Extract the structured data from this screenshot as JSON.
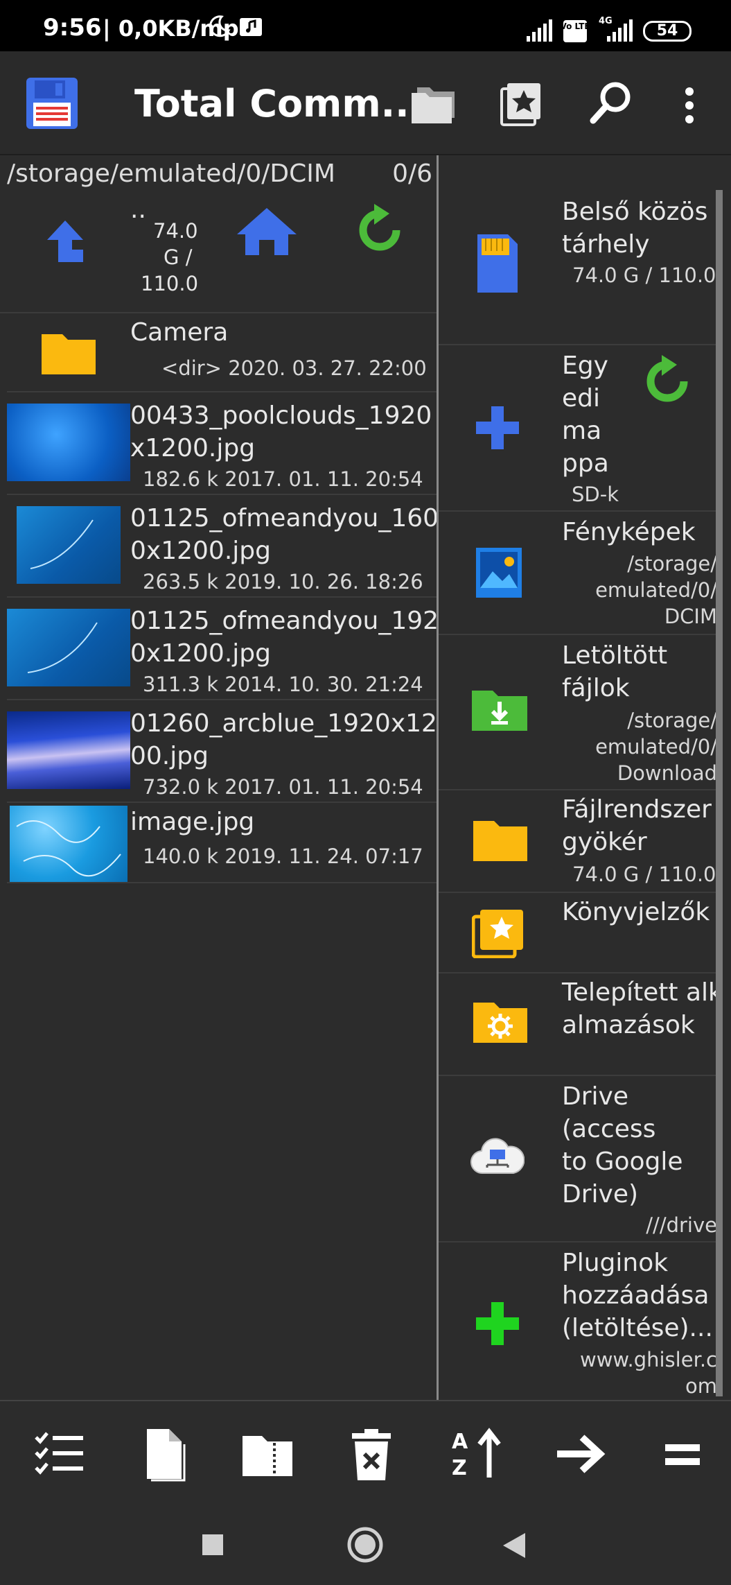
{
  "status_bar": {
    "time": "9:56",
    "network_speed": "| 0,0KB/mp",
    "battery": "54",
    "volte": "Vo LTE",
    "net_4g": "4G"
  },
  "header": {
    "title": "Total Comm..."
  },
  "left_panel": {
    "path": "/storage/emulated/0/DCIM",
    "count": "0/6",
    "up_label": "..",
    "up_size": [
      "74.0",
      "G /",
      "110.0"
    ],
    "items": [
      {
        "name": [
          "Camera"
        ],
        "meta": "<dir>  2020. 03. 27.  22:00",
        "type": "folder"
      },
      {
        "name": [
          "00433_poolclouds_1920",
          "x1200.jpg"
        ],
        "meta": "182.6 k  2017. 01. 11.  20:54",
        "type": "image"
      },
      {
        "name": [
          "01125_ofmeandyou_160",
          "0x1200.jpg"
        ],
        "meta": "263.5 k  2019. 10. 26.  18:26",
        "type": "image"
      },
      {
        "name": [
          "01125_ofmeandyou_192",
          "0x1200.jpg"
        ],
        "meta": "311.3 k  2014. 10. 30.  21:24",
        "type": "image"
      },
      {
        "name": [
          "01260_arcblue_1920x12",
          "00.jpg"
        ],
        "meta": "732.0 k  2017. 01. 11.  20:54",
        "type": "image"
      },
      {
        "name": [
          "image.jpg"
        ],
        "meta": "140.0 k  2019. 11. 24.  07:17",
        "type": "image"
      }
    ]
  },
  "right_panel": {
    "items": [
      {
        "label": [
          "Belső közös",
          "tárhely"
        ],
        "sub": [
          "74.0 G / 110.0"
        ],
        "icon": "sd-card-icon"
      },
      {
        "label": [
          "Egy",
          "edi",
          "ma",
          "ppa"
        ],
        "sub": [
          "SD-k"
        ],
        "icon": "plus-icon"
      },
      {
        "label": [
          "Fényképek"
        ],
        "sub": [
          "/storage/",
          "emulated/0/",
          "DCIM"
        ],
        "icon": "photos-icon"
      },
      {
        "label": [
          "Letöltött",
          "fájlok"
        ],
        "sub": [
          "/storage/",
          "emulated/0/",
          "Download"
        ],
        "icon": "download-folder-icon"
      },
      {
        "label": [
          "Fájlrendszer",
          "gyökér"
        ],
        "sub": [
          "74.0 G / 110.0"
        ],
        "icon": "folder-icon"
      },
      {
        "label": [
          "Könyvjelzők"
        ],
        "sub": [],
        "icon": "bookmarks-icon"
      },
      {
        "label": [
          "Telepített alk",
          "almazások"
        ],
        "sub": [],
        "icon": "apps-folder-icon"
      },
      {
        "label": [
          "Drive",
          "(access",
          "to Google",
          "Drive)"
        ],
        "sub": [
          "///drive"
        ],
        "icon": "cloud-drive-icon"
      },
      {
        "label": [
          "Pluginok",
          "hozzáadása",
          "(letöltése)..."
        ],
        "sub": [
          "www.ghisler.c",
          "om"
        ],
        "icon": "green-plus-icon"
      }
    ]
  },
  "colors": {
    "folder": "#fbb90f",
    "blue_accent": "#3f6fe8",
    "green_refresh": "#4cbb3a",
    "background": "#2c2c2c"
  }
}
